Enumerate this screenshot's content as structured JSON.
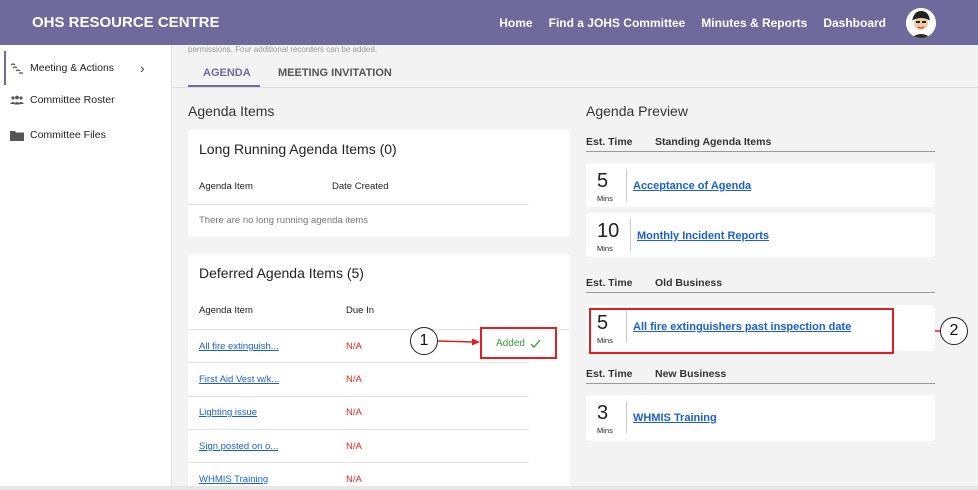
{
  "header": {
    "brand": "OHS RESOURCE CENTRE",
    "nav": [
      "Home",
      "Find a JOHS Committee",
      "Minutes & Reports",
      "Dashboard"
    ],
    "accent": "#6e6a9b"
  },
  "sidebar": {
    "items": [
      {
        "label": "Meeting & Actions",
        "icon": "wave-icon"
      },
      {
        "label": "Committee Roster",
        "icon": "people-icon"
      },
      {
        "label": "Committee Files",
        "icon": "folder-icon"
      }
    ]
  },
  "page": {
    "permissions_text": "permissions. Four additional recorders can be added.",
    "tabs": [
      "AGENDA",
      "MEETING INVITATION"
    ],
    "agenda_items_title": "Agenda Items",
    "agenda_preview_title": "Agenda Preview"
  },
  "long_running": {
    "title": "Long Running Agenda Items (0)",
    "col_item": "Agenda Item",
    "col_date": "Date Created",
    "empty": "There are no long running agenda items"
  },
  "deferred": {
    "title": "Deferred Agenda Items (5)",
    "col_item": "Agenda Item",
    "col_due": "Due In",
    "rows": [
      {
        "item": "All fire extinguish...",
        "due": "N/A"
      },
      {
        "item": "First Aid Vest w/k...",
        "due": "N/A"
      },
      {
        "item": "Lighting issue",
        "due": "N/A"
      },
      {
        "item": "Sign posted on o...",
        "due": "N/A"
      },
      {
        "item": "WHMIS Training",
        "due": "N/A"
      }
    ],
    "added_label": "Added"
  },
  "callouts": [
    "1",
    "2"
  ],
  "preview": {
    "est_time": "Est. Time",
    "sections": [
      {
        "name": "Standing Agenda Items",
        "items": [
          {
            "mins": "5",
            "unit": "Mins",
            "title": "Acceptance of Agenda"
          },
          {
            "mins": "10",
            "unit": "Mins",
            "title": "Monthly Incident Reports"
          }
        ]
      },
      {
        "name": "Old Business",
        "items": [
          {
            "mins": "5",
            "unit": "Mins",
            "title": "All fire extinguishers past inspection date"
          }
        ]
      },
      {
        "name": "New Business",
        "items": [
          {
            "mins": "3",
            "unit": "Mins",
            "title": "WHMIS Training"
          }
        ]
      }
    ]
  }
}
